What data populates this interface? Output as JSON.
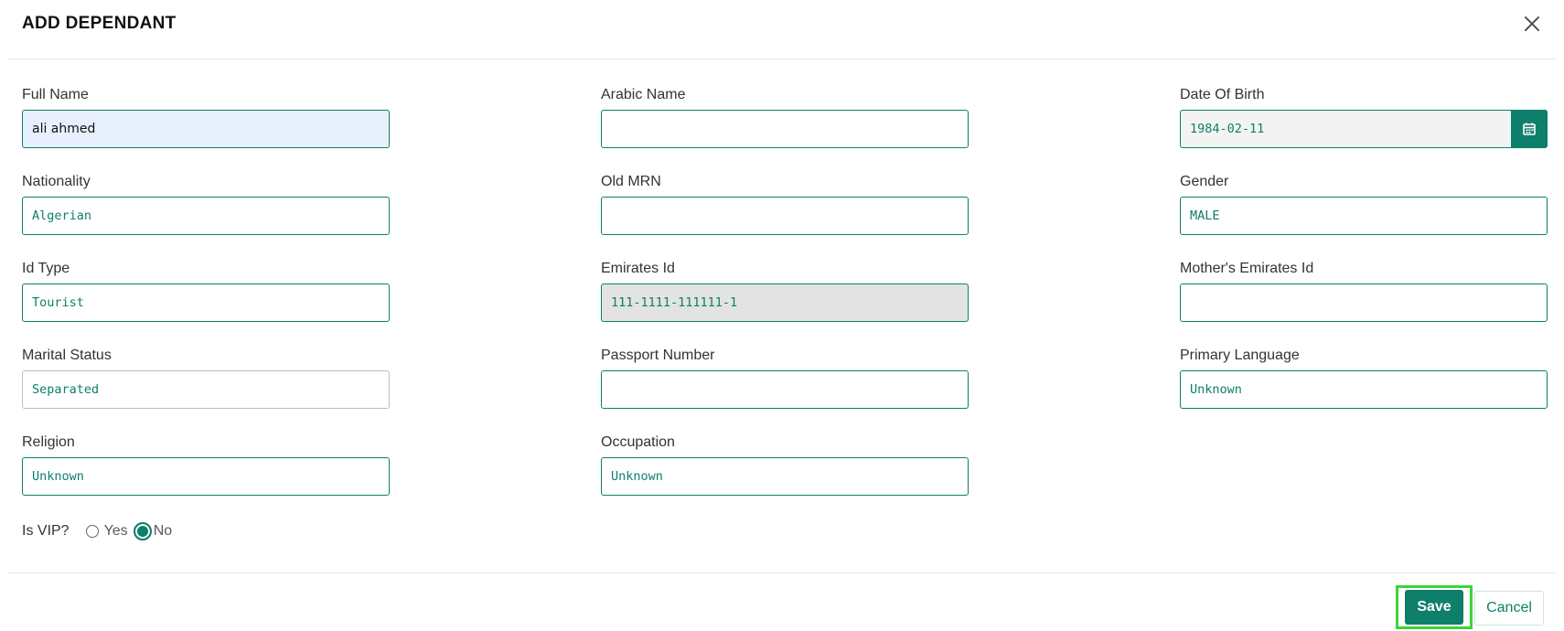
{
  "modal": {
    "title": "ADD DEPENDANT",
    "close_icon": "close-icon"
  },
  "fields": {
    "full_name": {
      "label": "Full Name",
      "value": "ali ahmed"
    },
    "arabic_name": {
      "label": "Arabic Name",
      "value": ""
    },
    "date_of_birth": {
      "label": "Date Of Birth",
      "value": "1984-02-11",
      "icon": "calendar-icon"
    },
    "nationality": {
      "label": "Nationality",
      "value": "Algerian"
    },
    "old_mrn": {
      "label": "Old MRN",
      "value": ""
    },
    "gender": {
      "label": "Gender",
      "value": "MALE"
    },
    "id_type": {
      "label": "Id Type",
      "value": "Tourist"
    },
    "emirates_id": {
      "label": "Emirates Id",
      "value": "111-1111-111111-1"
    },
    "mothers_emirates_id": {
      "label": "Mother's Emirates Id",
      "value": ""
    },
    "marital_status": {
      "label": "Marital Status",
      "value": "Separated"
    },
    "passport_number": {
      "label": "Passport Number",
      "value": ""
    },
    "primary_language": {
      "label": "Primary Language",
      "value": "Unknown"
    },
    "religion": {
      "label": "Religion",
      "value": "Unknown"
    },
    "occupation": {
      "label": "Occupation",
      "value": "Unknown"
    }
  },
  "vip": {
    "label": "Is VIP?",
    "options": [
      "Yes",
      "No"
    ],
    "selected": "No"
  },
  "footer": {
    "save_label": "Save",
    "cancel_label": "Cancel"
  },
  "colors": {
    "accent": "#0d7f6a",
    "highlight": "#39d639",
    "autofill_bg": "#e8f0fe",
    "readonly_bg": "#e3e3e3"
  }
}
